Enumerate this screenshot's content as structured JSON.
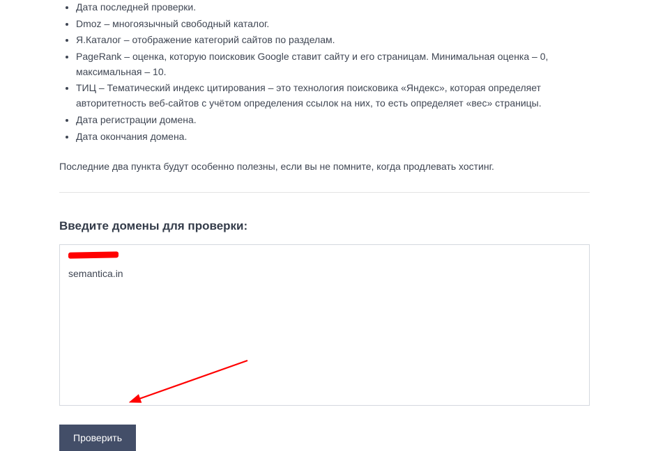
{
  "list": {
    "items": [
      "Дата последней проверки.",
      "Dmoz – многоязычный свободный каталог.",
      "Я.Каталог – отображение категорий сайтов по разделам.",
      "PageRank – оценка, которую поисковик Google ставит сайту и его страницам. Минимальная оценка – 0, максимальная – 10.",
      "ТИЦ – Тематический индекс цитирования – это технология поисковика «Яндекс», которая определяет авторитетность веб-сайтов с учётом определения ссылок на них, то есть определяет «вес» страницы.",
      "Дата регистрации домена.",
      "Дата окончания домена."
    ]
  },
  "note": "Последние два пункта будут особенно полезны, если вы не помните, когда продлевать хостинг.",
  "form": {
    "heading": "Введите домены для проверки:",
    "textarea_value": "\nsemantica.in",
    "submit_label": "Проверить"
  },
  "colors": {
    "button_bg": "#434e68",
    "arrow": "#ff0000",
    "text": "#3f4653",
    "border": "#d4d8de"
  }
}
